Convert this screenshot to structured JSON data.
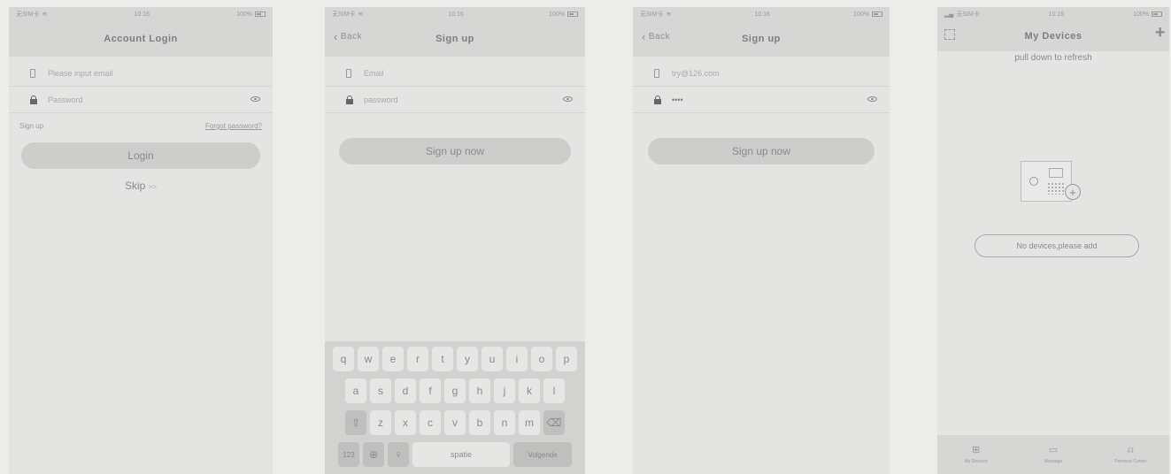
{
  "statusbar": {
    "carrier": "无SIM卡",
    "time": "10:16",
    "battery": "100%"
  },
  "login": {
    "title": "Account Login",
    "email_placeholder": "Please input email",
    "password_placeholder": "Password",
    "signup_link": "Sign up",
    "forgot_link": "Forgot password?",
    "login_button": "Login",
    "skip_label": "Skip",
    "skip_arrow": ">>"
  },
  "signup_keyboard": {
    "back_label": "Back",
    "title": "Sign up",
    "email_placeholder": "Email",
    "password_placeholder": "password",
    "submit_button": "Sign up now",
    "keyboard": {
      "row1": [
        "q",
        "w",
        "e",
        "r",
        "t",
        "y",
        "u",
        "i",
        "o",
        "p"
      ],
      "row2": [
        "a",
        "s",
        "d",
        "f",
        "g",
        "h",
        "j",
        "k",
        "l"
      ],
      "row3": [
        "z",
        "x",
        "c",
        "v",
        "b",
        "n",
        "m"
      ],
      "numbers_key": "123",
      "space_key": "spatie",
      "next_key": "Volgende"
    }
  },
  "signup_filled": {
    "back_label": "Back",
    "title": "Sign up",
    "email_value": "try@126.com",
    "password_value": "••••",
    "submit_button": "Sign up now"
  },
  "devices": {
    "title": "My Devices",
    "pull_hint": "pull down to refresh",
    "empty_button": "No devices,please add",
    "tabs": [
      {
        "label": "My Devices",
        "icon": "grid-icon"
      },
      {
        "label": "Message",
        "icon": "message-icon"
      },
      {
        "label": "Personal Center",
        "icon": "person-icon"
      }
    ]
  },
  "colors": {
    "background": "#e4e4e3",
    "bar": "#d6d6d5",
    "button": "#cdcdcc"
  }
}
